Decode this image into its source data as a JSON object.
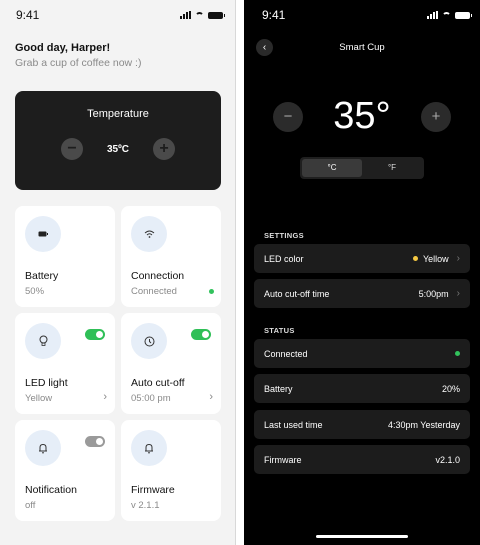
{
  "left": {
    "status_time": "9:41",
    "greeting": "Good day, Harper!",
    "subtitle": "Grab a cup of coffee now :)",
    "temperature": {
      "title": "Temperature",
      "value": "35ºC",
      "minus": "−",
      "plus": "+"
    },
    "tiles": [
      {
        "name": "Battery",
        "value": "50%",
        "icon": "battery-icon"
      },
      {
        "name": "Connection",
        "value": "Connected",
        "icon": "wifi-icon",
        "status_color": "#32c25c"
      },
      {
        "name": "LED light",
        "value": "Yellow",
        "icon": "lightbulb-icon",
        "toggle": true
      },
      {
        "name": "Auto cut-off",
        "value": "05:00 pm",
        "icon": "clock-icon",
        "toggle": true
      },
      {
        "name": "Notification",
        "value": "off",
        "icon": "bell-icon",
        "toggle": false
      },
      {
        "name": "Firmware",
        "value": "v 2.1.1",
        "icon": "bell-icon"
      }
    ]
  },
  "right": {
    "status_time": "9:41",
    "title": "Smart Cup",
    "temperature_value": "35°",
    "minus": "−",
    "plus": "+",
    "units": [
      "°C",
      "°F"
    ],
    "active_unit": "°C",
    "settings_header": "SETTINGS",
    "settings": [
      {
        "label": "LED color",
        "value": "Yellow",
        "dot_color": "#f5c842"
      },
      {
        "label": "Auto cut-off time",
        "value": "5:00pm"
      }
    ],
    "status_header": "STATUS",
    "status": [
      {
        "label": "Connected",
        "dot_color": "#32c25c"
      },
      {
        "label": "Battery",
        "value": "20%"
      },
      {
        "label": "Last used time",
        "value": "4:30pm Yesterday"
      },
      {
        "label": "Firmware",
        "value": "v2.1.0"
      }
    ]
  }
}
